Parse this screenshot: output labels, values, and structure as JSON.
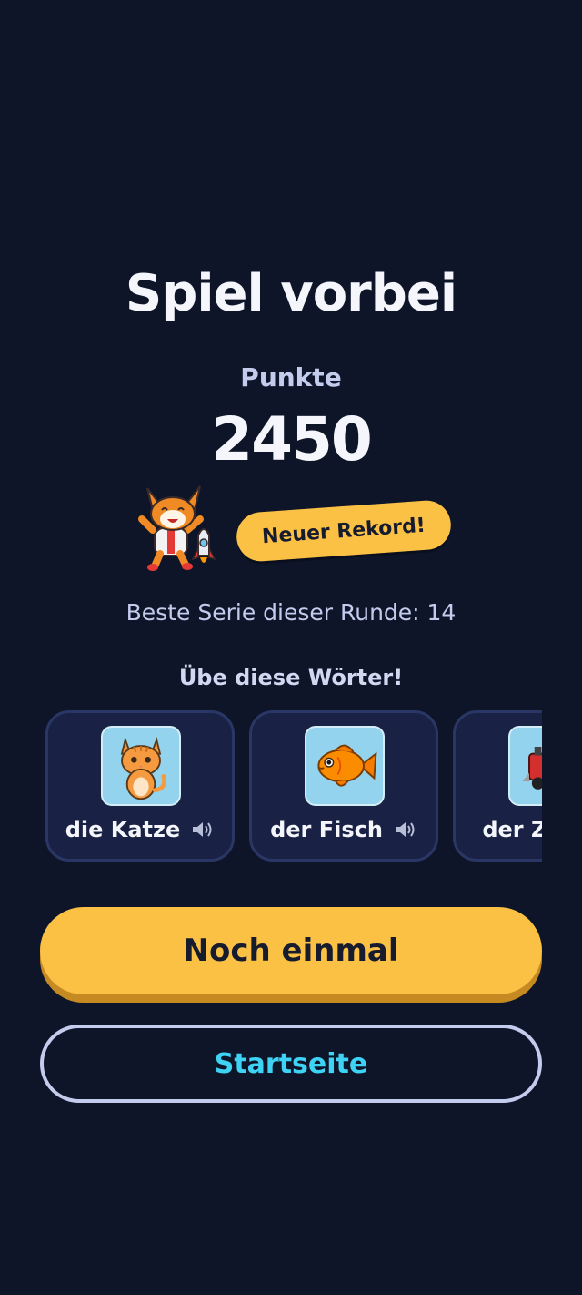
{
  "game_over": {
    "title": "Spiel vorbei",
    "score_label": "Punkte",
    "score_value": "2450",
    "record_badge": "Neuer Rekord!",
    "best_streak": "Beste Serie dieser Runde: 14"
  },
  "practice": {
    "heading": "Übe diese Wörter!",
    "words": [
      {
        "label": "die Katze",
        "icon": "cat-illustration"
      },
      {
        "label": "der Fisch",
        "icon": "fish-illustration"
      },
      {
        "label": "der Zug",
        "icon": "train-illustration"
      }
    ]
  },
  "buttons": {
    "play_again": "Noch einmal",
    "home": "Startseite"
  },
  "colors": {
    "background": "#0e1529",
    "accent_yellow": "#fbc145",
    "accent_cyan": "#3ed3f4",
    "card_bg": "#192244"
  }
}
